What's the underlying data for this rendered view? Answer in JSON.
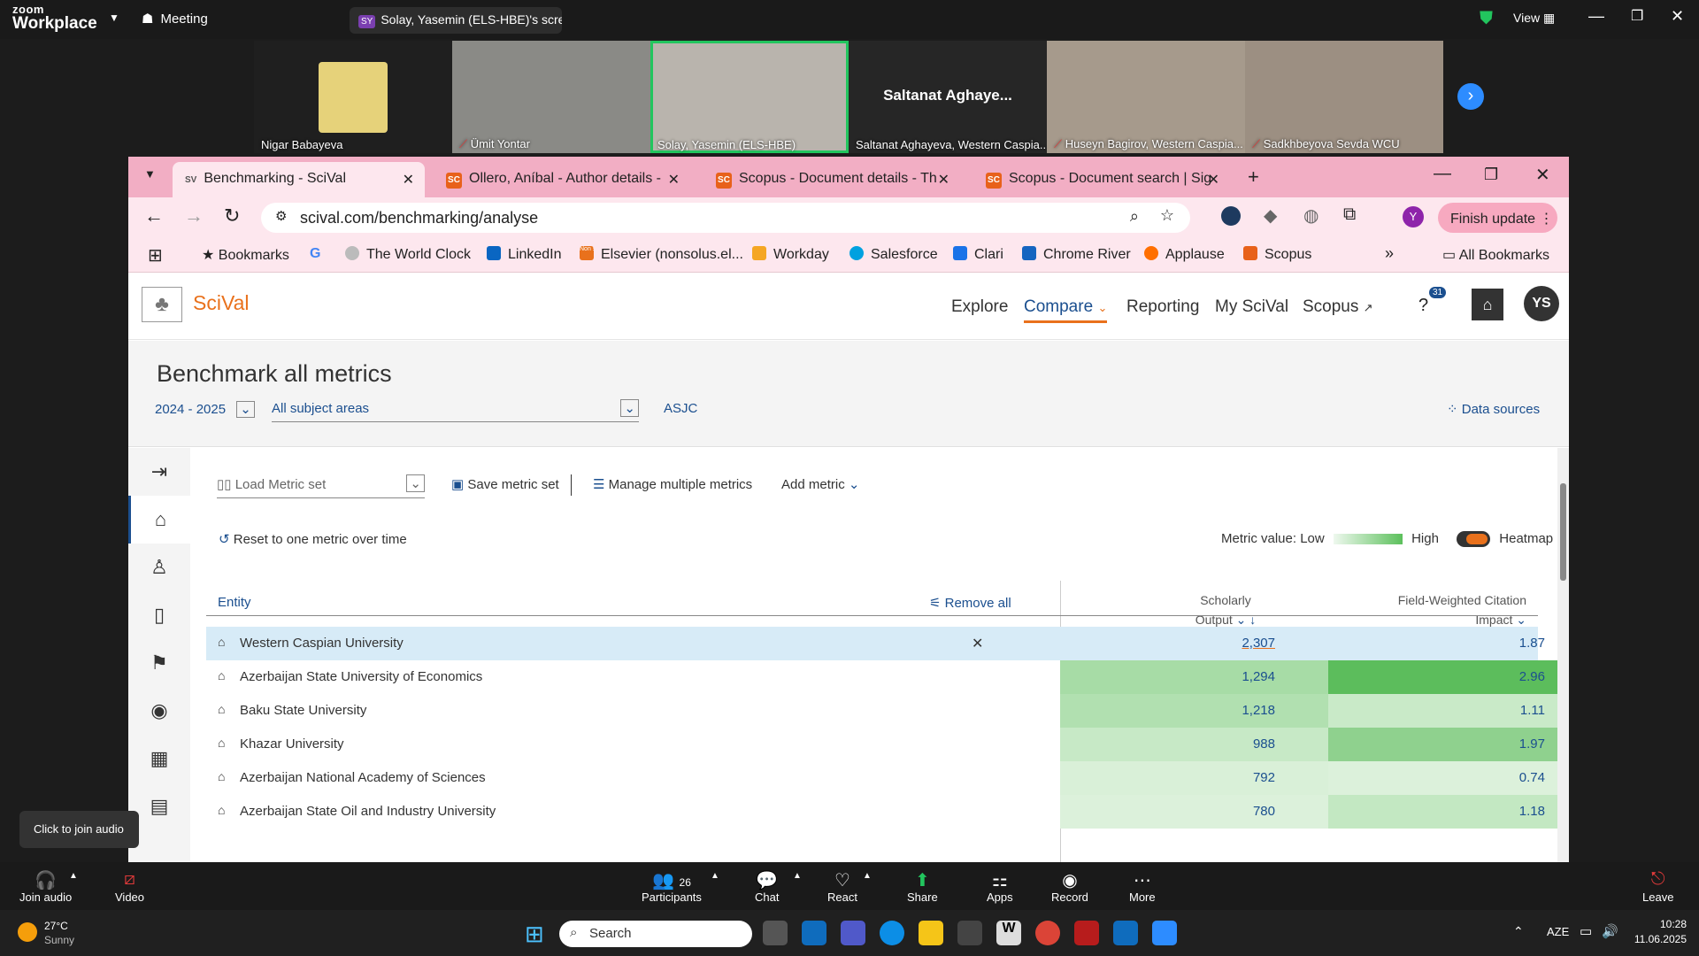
{
  "zoom": {
    "logo_line1": "zoom",
    "logo_line2": "Workplace",
    "meeting_label": "Meeting",
    "share_badge": "SY",
    "share_label": "Solay, Yasemin (ELS-HBE)'s screen",
    "view_label": "View",
    "participants": [
      {
        "name": "Nigar Babayeva"
      },
      {
        "name": "Ümit Yontar"
      },
      {
        "name": "Solay, Yasemin (ELS-HBE)"
      },
      {
        "name": "Saltanat Aghayeva, Western Caspia...",
        "display": "Saltanat  Aghaye..."
      },
      {
        "name": "Huseyn Bagirov, Western Caspia..."
      },
      {
        "name": "Sadkhbeyova Sevda WCU"
      }
    ],
    "bottom": {
      "join_audio": "Join audio",
      "video": "Video",
      "participants": "Participants",
      "participants_count": "26",
      "chat": "Chat",
      "react": "React",
      "share": "Share",
      "apps": "Apps",
      "record": "Record",
      "more": "More",
      "leave": "Leave"
    },
    "tooltip": "Click to join audio"
  },
  "browser": {
    "tabs": [
      {
        "icon": "SV",
        "title": "Benchmarking - SciVal"
      },
      {
        "icon": "SC",
        "title": "Ollero, Aníbal - Author details -"
      },
      {
        "icon": "SC",
        "title": "Scopus - Document details - Th"
      },
      {
        "icon": "SC",
        "title": "Scopus - Document search | Sig"
      }
    ],
    "url": "scival.com/benchmarking/analyse",
    "profile": "Y",
    "finish_update": "Finish update",
    "bookmarks": [
      "Bookmarks",
      "The World Clock",
      "LinkedIn",
      "Elsevier (nonsolus.el...",
      "Workday",
      "Salesforce",
      "Clari",
      "Chrome River",
      "Applause",
      "Scopus"
    ],
    "all_bookmarks": "All Bookmarks",
    "google_glyph": "G",
    "elsevier_badge": "Non solus"
  },
  "scival": {
    "logo": "SciVal",
    "nav": [
      "Explore",
      "Compare",
      "Reporting",
      "My SciVal",
      "Scopus"
    ],
    "help_badge": "31",
    "avatar": "YS",
    "title": "Benchmark all metrics",
    "years": "2024 - 2025",
    "subject": "All subject areas",
    "asjc": "ASJC",
    "data_sources": "Data sources",
    "load_metric": "Load Metric set",
    "save_metric": "Save metric set",
    "manage": "Manage multiple metrics",
    "add_metric": "Add metric",
    "reset": "Reset to one metric over time",
    "metric_value": "Metric value:",
    "low": "Low",
    "high": "High",
    "heatmap": "Heatmap",
    "entity_header": "Entity",
    "remove_all": "Remove all",
    "col1_l1": "Scholarly",
    "col1_l2": "Output",
    "col2_l1": "Field-Weighted Citation",
    "col2_l2": "Impact",
    "rows": [
      {
        "name": "Western Caspian University",
        "output": "2,307",
        "fwci": "1.87"
      },
      {
        "name": "Azerbaijan State University of Economics",
        "output": "1,294",
        "fwci": "2.96"
      },
      {
        "name": "Baku State University",
        "output": "1,218",
        "fwci": "1.11"
      },
      {
        "name": "Khazar University",
        "output": "988",
        "fwci": "1.97"
      },
      {
        "name": "Azerbaijan National Academy of Sciences",
        "output": "792",
        "fwci": "0.74"
      },
      {
        "name": "Azerbaijan State Oil and Industry University",
        "output": "780",
        "fwci": "1.18"
      }
    ]
  },
  "taskbar": {
    "temp": "27°C",
    "weather": "Sunny",
    "search": "Search",
    "lang": "AZE",
    "time": "10:28",
    "date": "11.06.2025"
  }
}
